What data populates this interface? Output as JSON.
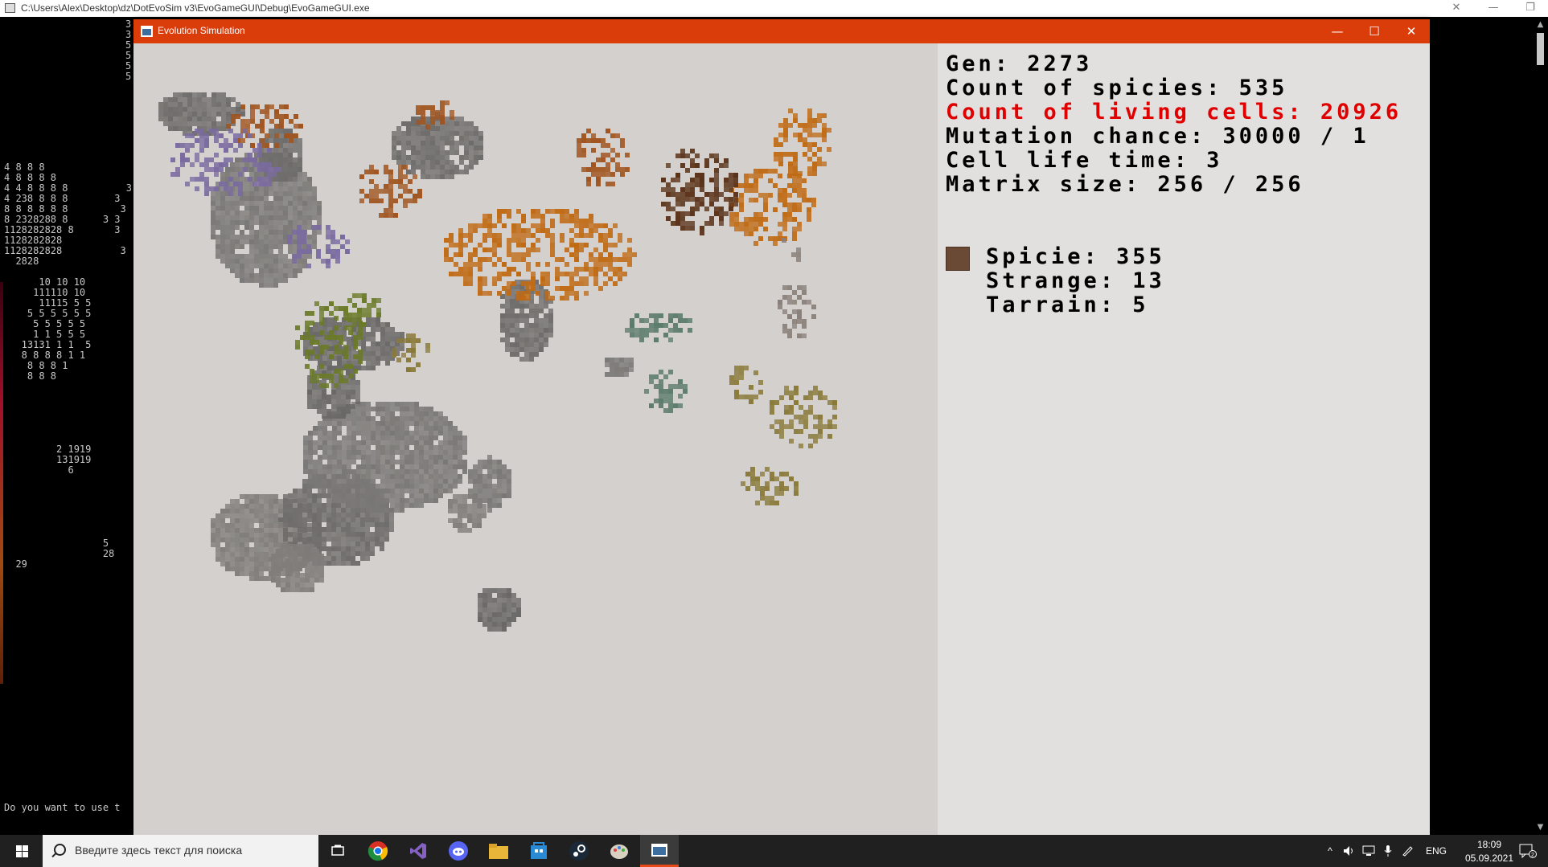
{
  "console": {
    "title": "C:\\Users\\Alex\\Desktop\\dz\\DotEvoSim v3\\EvoGameGUI\\Debug\\EvoGameGUI.exe",
    "minimize": "—",
    "restore": "❐",
    "close": "✕",
    "right_digits": [
      "3",
      "3",
      "5",
      "5",
      "5",
      "5"
    ],
    "lines": [
      "4 8 8 8",
      "4 8 8 8 8",
      "4 4 8 8 8 8          3",
      "4 238 8 8 8        3",
      "8 8 8 8 8 8         3",
      "8 2328288 8      3 3",
      "1128282828 8       3",
      "1128282828",
      "1128282828          3",
      "  2828",
      "",
      "      10 10 10",
      "     111110 10",
      "      11115 5 5",
      "    5 5 5 5 5 5",
      "     5 5 5 5 5",
      "     1 1 5 5 5",
      "   13131 1 1  5",
      "   8 8 8 8 1 1",
      "    8 8 8 1",
      "    8 8 8",
      "",
      "",
      "",
      "",
      "",
      "",
      "         2 1919",
      "         131919",
      "           6",
      "",
      "",
      "",
      "",
      "",
      "",
      "                 5",
      "                 28",
      "  29"
    ],
    "prompt": "Do you want to use t"
  },
  "evo": {
    "title": "Evolution Simulation",
    "minimize": "—",
    "maximize": "☐",
    "close": "✕",
    "stats": {
      "gen": "Gen: 2273",
      "species": "Count of spicies: 535",
      "living": "Count of living cells: 20926",
      "mutation": "Mutation chance: 30000 / 1",
      "lifetime": "Cell life time: 3",
      "matrix": "Matrix size: 256 / 256"
    },
    "selected": {
      "color": "#6b4a35",
      "specie": "Spicie: 355",
      "strange": "Strange: 13",
      "terrain": "Tarrain: 5"
    }
  },
  "colonies": [
    {
      "color": "#6e6c6a"
    },
    {
      "color": "#7a7876"
    },
    {
      "color": "#807d7a"
    },
    {
      "color": "#6a6866"
    },
    {
      "color": "#a0541e"
    },
    {
      "color": "#c06a14"
    },
    {
      "color": "#5a3218"
    },
    {
      "color": "#7a6aa0"
    },
    {
      "color": "#6a7a28"
    },
    {
      "color": "#5a7a6a"
    },
    {
      "color": "#8a7a3a"
    },
    {
      "color": "#8a807a"
    }
  ],
  "taskbar": {
    "search_placeholder": "Введите здесь текст для поиска",
    "lang": "ENG",
    "time": "18:09",
    "date": "05.09.2021",
    "notif": "2",
    "accent": "#e64a19"
  }
}
